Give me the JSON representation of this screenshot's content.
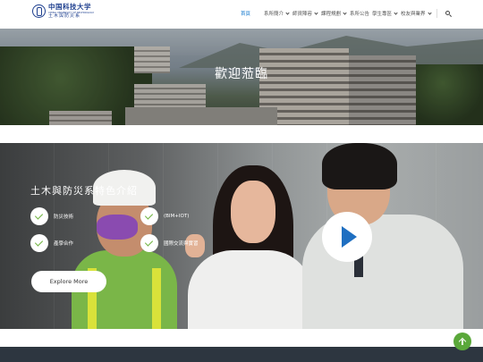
{
  "header": {
    "logo": {
      "name": "中国科技大学",
      "english": "CHINA UNIVERSITY OF TECHNOLOGY",
      "dept": "土木與防災系"
    },
    "nav": [
      {
        "label": "首頁",
        "active": true,
        "dropdown": false
      },
      {
        "label": "系所簡介",
        "active": false,
        "dropdown": true
      },
      {
        "label": "師資陣容",
        "active": false,
        "dropdown": true
      },
      {
        "label": "課程規劃",
        "active": false,
        "dropdown": true
      },
      {
        "label": "系所公告",
        "active": false,
        "dropdown": false
      },
      {
        "label": "學生專區",
        "active": false,
        "dropdown": true
      },
      {
        "label": "校友與業界",
        "active": false,
        "dropdown": true
      }
    ],
    "search_icon": "search-icon"
  },
  "hero": {
    "title": "歡迎蒞臨"
  },
  "feature": {
    "title": "土木與防災系特色介紹",
    "checks": [
      {
        "label": "防災技術"
      },
      {
        "label": "(BIM+IOT)"
      },
      {
        "label": "產學合作"
      },
      {
        "label": "國際交流與實習"
      }
    ],
    "explore_label": "Explore More",
    "play_icon": "play-icon"
  },
  "colors": {
    "accent": "#1f7fd0",
    "check_green": "#6fb33f",
    "totop_green": "#5aa83a",
    "footer": "#2d3640"
  }
}
